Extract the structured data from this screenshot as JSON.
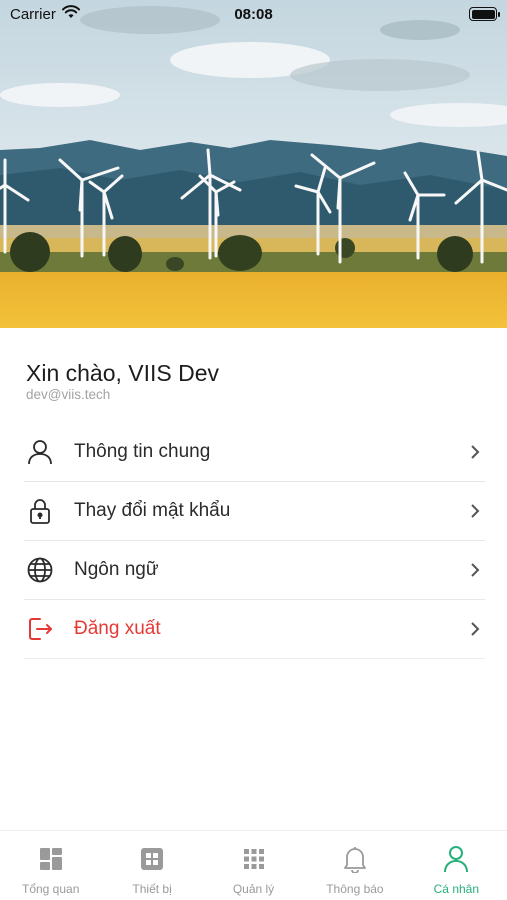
{
  "status_bar": {
    "carrier": "Carrier",
    "time": "08:08"
  },
  "profile": {
    "greeting": "Xin chào, VIIS Dev",
    "email": "dev@viis.tech"
  },
  "menu": {
    "items": [
      {
        "label": "Thông tin chung",
        "icon": "user-icon"
      },
      {
        "label": "Thay đổi mật khẩu",
        "icon": "lock-icon"
      },
      {
        "label": "Ngôn ngữ",
        "icon": "globe-icon"
      },
      {
        "label": "Đăng xuất",
        "icon": "logout-icon",
        "color": "#e53935"
      }
    ]
  },
  "tabbar": {
    "tabs": [
      {
        "label": "Tổng quan",
        "icon": "dashboard-icon"
      },
      {
        "label": "Thiết bị",
        "icon": "device-icon"
      },
      {
        "label": "Quản lý",
        "icon": "grid-icon"
      },
      {
        "label": "Thông báo",
        "icon": "bell-icon"
      },
      {
        "label": "Cá nhân",
        "icon": "person-icon",
        "active": true
      }
    ],
    "active_color": "#26b07a",
    "inactive_color": "#9a9a9a"
  }
}
